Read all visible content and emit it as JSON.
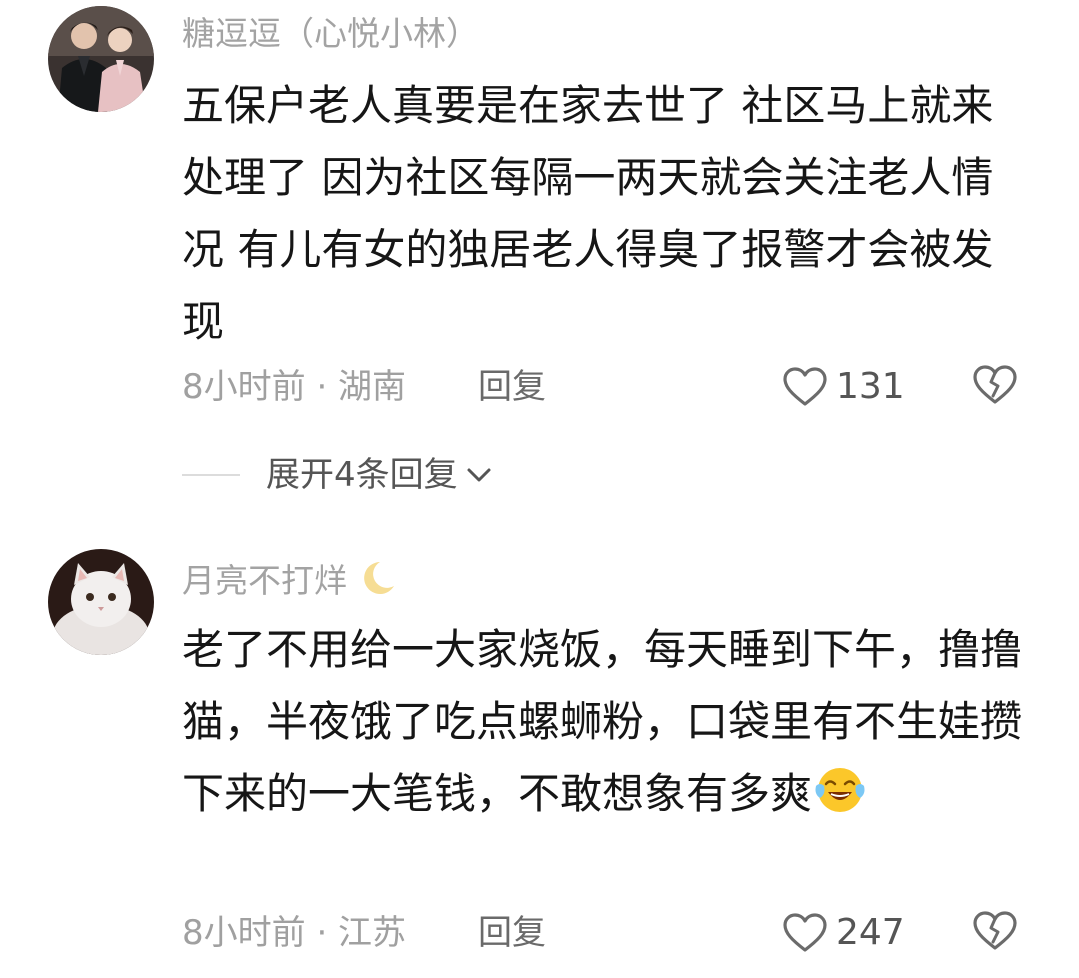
{
  "comments": [
    {
      "username": "糖逗逗（心悦小林）",
      "content": "五保户老人真要是在家去世了 社区马上就来处理了 因为社区每隔一两天就会关注老人情况 有儿有女的独居老人得臭了报警才会被发现",
      "time_location": "8小时前 · 湖南",
      "reply_label": "回复",
      "like_count": "131",
      "expand_label": "展开4条回复",
      "avatar_icon": "two-men-photo"
    },
    {
      "username": "月亮不打烊",
      "username_emoji": "crescent-moon",
      "content": "老了不用给一大家烧饭，每天睡到下午，撸撸猫，半夜饿了吃点螺蛳粉，口袋里有不生娃攒下来的一大笔钱，不敢想象有多爽",
      "content_emoji": "crying-laughing-face",
      "time_location": "8小时前 · 江苏",
      "reply_label": "回复",
      "like_count": "247",
      "avatar_icon": "white-persian-cat-photo"
    }
  ],
  "colors": {
    "username": "#a3a3a3",
    "content": "#161616",
    "meta": "#a0a0a0",
    "icon": "#6b6b6b"
  }
}
